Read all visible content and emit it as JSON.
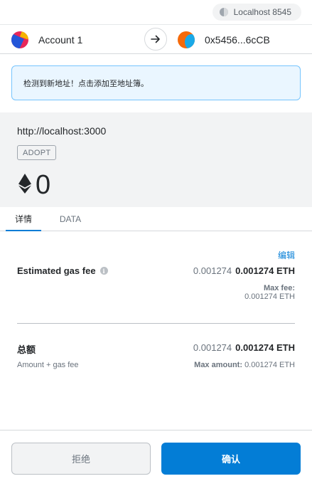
{
  "network": {
    "label": "Localhost 8545",
    "icon": "network-dot-icon"
  },
  "accounts": {
    "from_name": "Account 1",
    "to_address": "0x5456...6cCB",
    "arrow_icon": "arrow-right-icon"
  },
  "notice": {
    "text": "检测到新地址！点击添加至地址簿。"
  },
  "origin": {
    "url": "http://localhost:3000",
    "method": "ADOPT",
    "amount": "0",
    "currency_icon": "ethereum-icon"
  },
  "tabs": [
    {
      "label": "详情",
      "active": true
    },
    {
      "label": "DATA",
      "active": false
    }
  ],
  "details": {
    "edit_label": "编辑",
    "gas": {
      "label": "Estimated gas fee",
      "secondary_value": "0.001274",
      "primary_value": "0.001274 ETH",
      "max_fee_label": "Max fee:",
      "max_fee_value": "0.001274 ETH"
    },
    "total": {
      "label": "总额",
      "secondary_value": "0.001274",
      "primary_value": "0.001274 ETH",
      "sub_label": "Amount + gas fee",
      "max_amount_label": "Max amount:",
      "max_amount_value": "0.001274 ETH"
    }
  },
  "footer": {
    "reject_label": "拒绝",
    "confirm_label": "确认"
  },
  "colors": {
    "accent": "#037dd6",
    "notice_bg": "#eaf6ff",
    "notice_border": "#75c4fd",
    "panel_bg": "#f2f3f4"
  }
}
